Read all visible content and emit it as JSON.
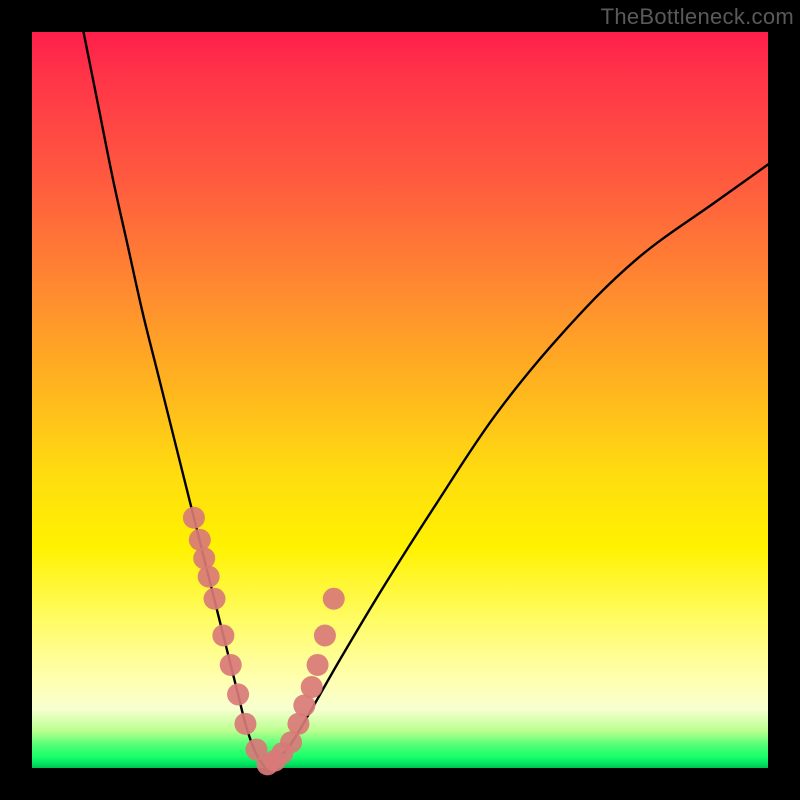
{
  "watermark": "TheBottleneck.com",
  "chart_data": {
    "type": "line",
    "title": "",
    "xlabel": "",
    "ylabel": "",
    "xlim": [
      0,
      100
    ],
    "ylim": [
      0,
      100
    ],
    "series": [
      {
        "name": "bottleneck-curve",
        "x": [
          7,
          9,
          11,
          13,
          15,
          17,
          19,
          21,
          22,
          23,
          24,
          25,
          26,
          27,
          28,
          29,
          30,
          31,
          32,
          33,
          35,
          38,
          42,
          48,
          55,
          63,
          72,
          82,
          93,
          100
        ],
        "values": [
          100,
          90,
          80,
          71,
          62,
          54,
          46,
          38,
          34,
          30,
          26,
          22,
          18,
          14,
          10,
          6,
          3,
          1,
          0,
          1,
          3,
          8,
          15,
          25,
          36,
          48,
          59,
          69,
          77,
          82
        ]
      }
    ],
    "markers": {
      "name": "highlight-points",
      "x": [
        22.0,
        22.8,
        23.4,
        24.0,
        24.8,
        26.0,
        27.0,
        28.0,
        29.0,
        30.5,
        32.0,
        33.0,
        34.0,
        35.2,
        36.2,
        37.0,
        38.0,
        38.8,
        39.8,
        41.0
      ],
      "values": [
        34,
        31,
        28.5,
        26,
        23,
        18,
        14,
        10,
        6,
        2.5,
        0.5,
        1,
        2,
        3.5,
        6,
        8.5,
        11,
        14,
        18,
        23
      ],
      "color": "#d97a78",
      "radius_px": 11
    },
    "gradient_stops": [
      {
        "pos": 0.0,
        "color": "#ff1f4b"
      },
      {
        "pos": 0.35,
        "color": "#ff8a30"
      },
      {
        "pos": 0.6,
        "color": "#ffdc10"
      },
      {
        "pos": 0.88,
        "color": "#ffffb0"
      },
      {
        "pos": 0.97,
        "color": "#4cff74"
      },
      {
        "pos": 1.0,
        "color": "#00c050"
      }
    ]
  }
}
